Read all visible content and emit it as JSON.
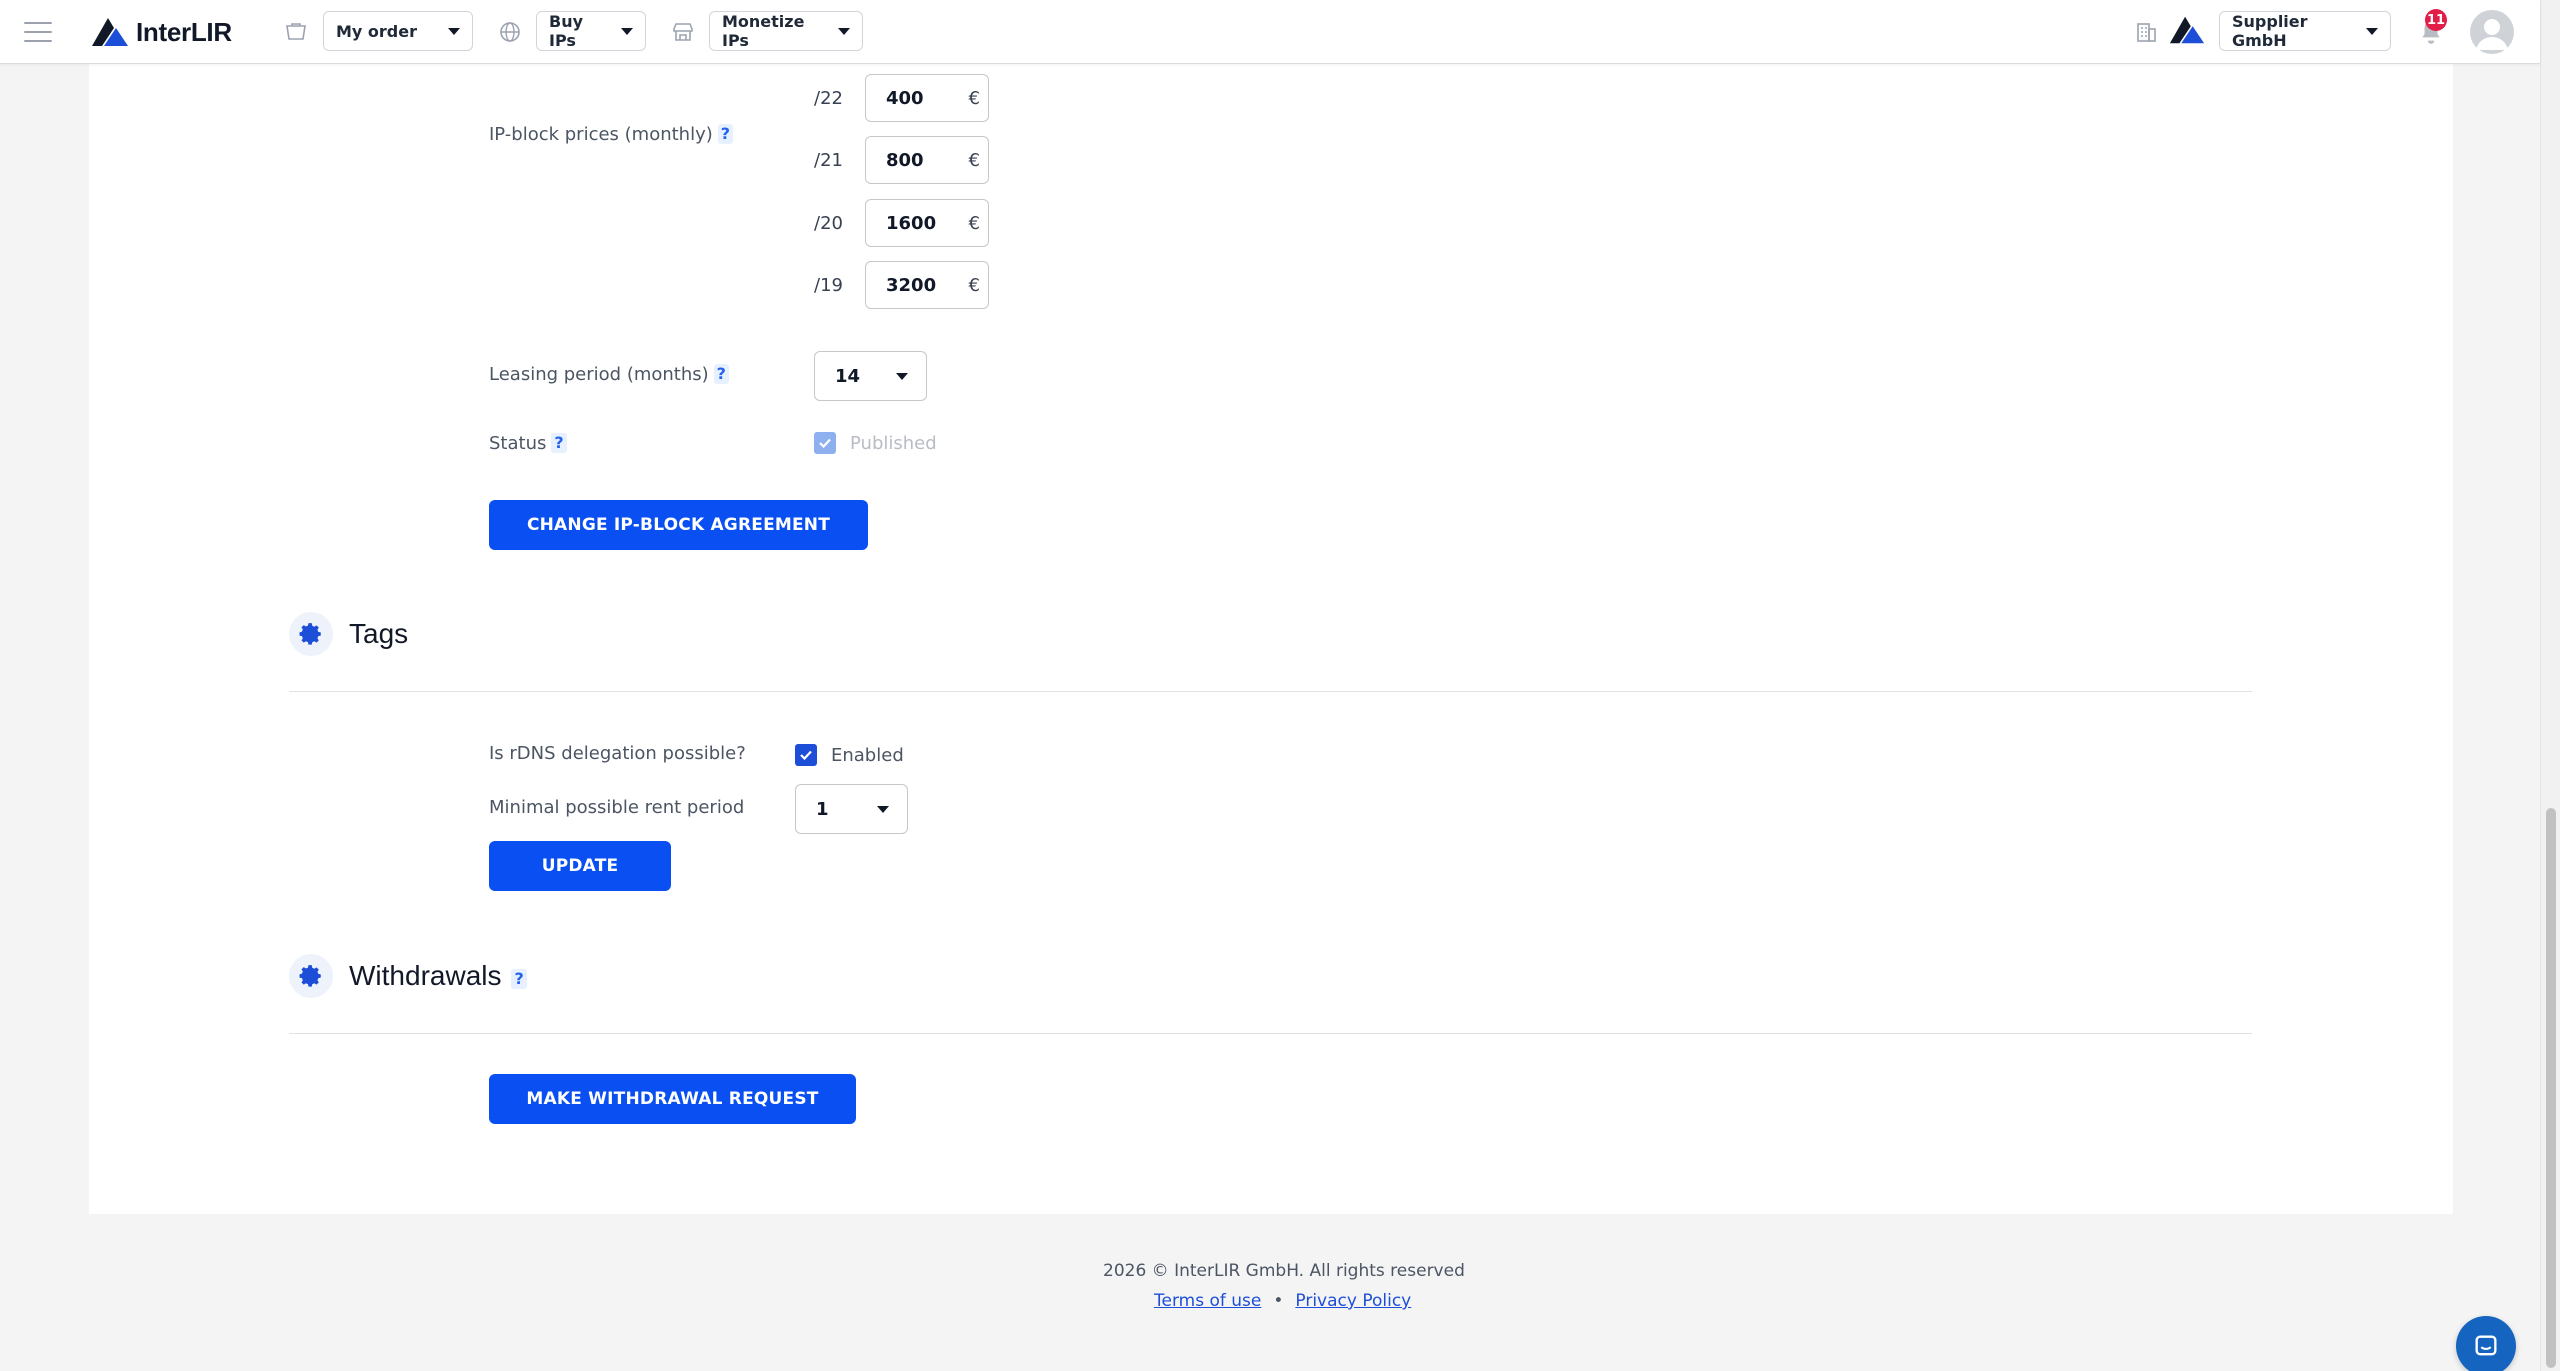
{
  "header": {
    "brand": "InterLIR",
    "menus": [
      {
        "label": "My order"
      },
      {
        "label": "Buy IPs"
      },
      {
        "label": "Monetize IPs"
      }
    ],
    "company": "Supplier GmbH",
    "notifications_count": "11"
  },
  "agreement": {
    "prices_label": "IP-block prices (monthly)",
    "help": "?",
    "currency": "€",
    "prices": [
      {
        "prefix": "/22",
        "value": "400"
      },
      {
        "prefix": "/21",
        "value": "800"
      },
      {
        "prefix": "/20",
        "value": "1600"
      },
      {
        "prefix": "/19",
        "value": "3200"
      }
    ],
    "leasing_label": "Leasing period (months)",
    "leasing_value": "14",
    "status_label": "Status",
    "status_value": "Published",
    "change_button": "CHANGE IP-BLOCK AGREEMENT"
  },
  "tags": {
    "title": "Tags",
    "rdns_label": "Is rDNS delegation possible?",
    "rdns_value": "Enabled",
    "min_rent_label": "Minimal possible rent period",
    "min_rent_value": "1",
    "update_button": "UPDATE"
  },
  "withdrawals": {
    "title": "Withdrawals",
    "help": "?",
    "button": "MAKE WITHDRAWAL REQUEST"
  },
  "footer": {
    "copyright": "2026 © InterLIR GmbH. All rights reserved",
    "terms": "Terms of use",
    "separator": "•",
    "privacy": "Privacy Policy"
  },
  "colors": {
    "primary": "#0a4ff2",
    "badge": "#e11d48",
    "background": "#f4f4f5"
  }
}
